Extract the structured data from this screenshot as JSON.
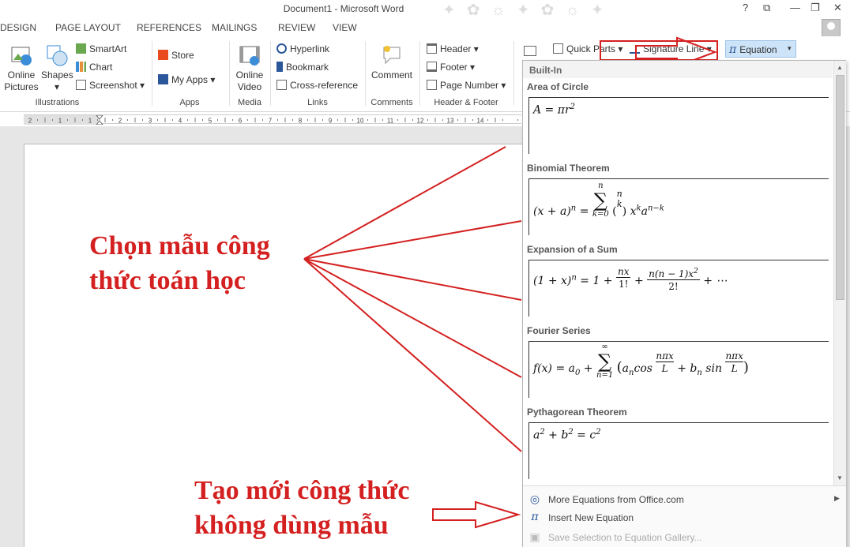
{
  "window": {
    "title": "Document1 - Microsoft Word",
    "help": "?",
    "restore": "❐",
    "maximize": "□",
    "close": "✕"
  },
  "tabs": [
    "DESIGN",
    "PAGE LAYOUT",
    "REFERENCES",
    "MAILINGS",
    "REVIEW",
    "VIEW"
  ],
  "ribbon": {
    "illustrations": {
      "online_pictures": "Online Pictures",
      "shapes": "Shapes",
      "smartart": "SmartArt",
      "chart": "Chart",
      "screenshot": "Screenshot",
      "label": "Illustrations"
    },
    "apps": {
      "store": "Store",
      "my_apps": "My Apps",
      "label": "Apps"
    },
    "media": {
      "online_video": "Online Video",
      "label": "Media"
    },
    "links": {
      "hyperlink": "Hyperlink",
      "bookmark": "Bookmark",
      "cross_reference": "Cross-reference",
      "label": "Links"
    },
    "comments": {
      "comment": "Comment",
      "label": "Comments"
    },
    "header_footer": {
      "header": "Header",
      "footer": "Footer",
      "page_number": "Page Number",
      "label": "Header & Footer"
    },
    "text": {
      "quick_parts": "Quick Parts",
      "signature_line": "Signature Line"
    },
    "symbols": {
      "equation": "Equation",
      "equation_icon": "π"
    }
  },
  "ruler": {
    "numbers": [
      "2",
      "1",
      "1",
      "2",
      "3",
      "4",
      "5",
      "6",
      "7",
      "8",
      "9",
      "10",
      "11",
      "12",
      "13",
      "14"
    ]
  },
  "gallery": {
    "header": "Built-In",
    "items": [
      {
        "title": "Area of Circle"
      },
      {
        "title": "Binomial Theorem"
      },
      {
        "title": "Expansion of a Sum"
      },
      {
        "title": "Fourier Series"
      },
      {
        "title": "Pythagorean Theorem"
      }
    ],
    "footer": {
      "more": "More Equations from Office.com",
      "insert_new": "Insert New Equation",
      "save_selection": "Save Selection to Equation Gallery..."
    }
  },
  "annotations": {
    "choose_line1": "Chọn mẫu công",
    "choose_line2": "thức toán học",
    "new_line1": "Tạo mới công thức",
    "new_line2": "không dùng mẫu",
    "color": "#d42020"
  }
}
